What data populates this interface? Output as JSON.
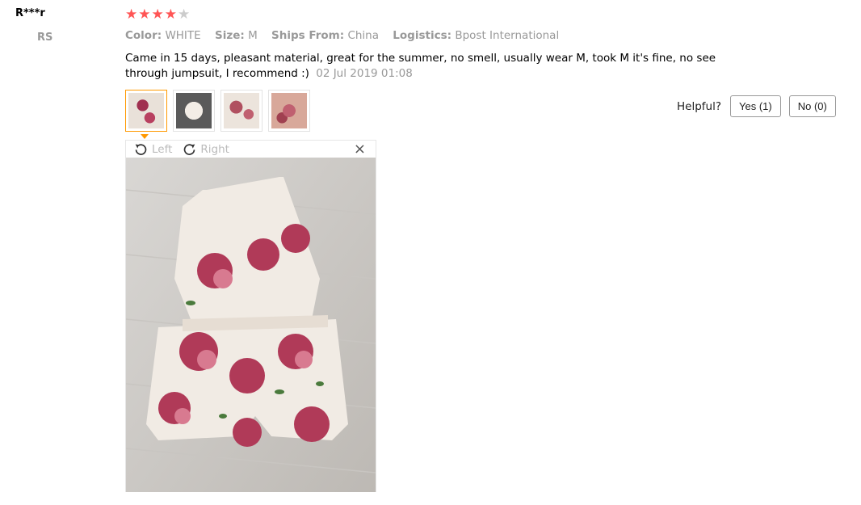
{
  "reviewer": {
    "name": "R***r",
    "country": "RS"
  },
  "rating": {
    "stars": 4,
    "max": 5
  },
  "properties": [
    {
      "key": "Color:",
      "value": "WHITE"
    },
    {
      "key": "Size:",
      "value": "M"
    },
    {
      "key": "Ships From:",
      "value": "China"
    },
    {
      "key": "Logistics:",
      "value": "Bpost International"
    }
  ],
  "review": {
    "text": "Came in 15 days, pleasant material, great for the summer, no smell, usually wear M, took M it's fine, no see through jumpsuit, I recommend :)",
    "date": "02 Jul 2019 01:08"
  },
  "viewer": {
    "rotate_left": "Left",
    "rotate_right": "Right",
    "close": "×"
  },
  "helpful": {
    "label": "Helpful?",
    "yes": "Yes (1)",
    "no": "No (0)"
  },
  "colors": {
    "star": "#ff5555",
    "accent": "#ff9900",
    "muted": "#999999"
  }
}
